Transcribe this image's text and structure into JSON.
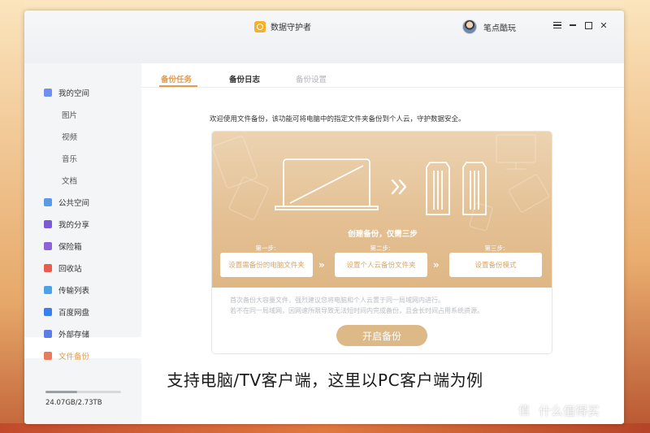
{
  "app": {
    "title": "数据守护者",
    "user_name": "笔点酷玩",
    "colors": {
      "accent": "#e59a4a",
      "hero": "#e3bf92",
      "sidebar_bg": "#f4f5f7"
    }
  },
  "sidebar": {
    "items": [
      {
        "label": "我的空间",
        "icon": "folder-icon",
        "color": "#6d8ff0"
      },
      {
        "label": "图片",
        "sub": true
      },
      {
        "label": "视频",
        "sub": true
      },
      {
        "label": "音乐",
        "sub": true
      },
      {
        "label": "文档",
        "sub": true
      },
      {
        "label": "公共空间",
        "icon": "send-icon",
        "color": "#5a9be8"
      },
      {
        "label": "我的分享",
        "icon": "share-icon",
        "color": "#7c5ad6"
      },
      {
        "label": "保险箱",
        "icon": "safe-icon",
        "color": "#8e63d9"
      },
      {
        "label": "回收站",
        "icon": "trash-icon",
        "color": "#e85d4b"
      },
      {
        "label": "传输列表",
        "icon": "transfer-icon",
        "color": "#4aa3e8"
      },
      {
        "label": "百度网盘",
        "icon": "cloud-icon",
        "color": "#3a7ff0"
      },
      {
        "label": "外部存储",
        "icon": "drive-icon",
        "color": "#5a7ee8"
      },
      {
        "label": "文件备份",
        "icon": "backup-icon",
        "color": "#e97a5c",
        "active": true
      }
    ],
    "storage": {
      "text": "24.07GB/2.73TB",
      "used_fraction": 0.42
    }
  },
  "tabs": [
    {
      "label": "备份任务",
      "state": "active"
    },
    {
      "label": "备份日志",
      "state": "normal"
    },
    {
      "label": "备份设置",
      "state": "disabled"
    }
  ],
  "main": {
    "intro": "欢迎使用文件备份，该功能可将电脑中的指定文件夹备份到个人云，守护数据安全。",
    "hero_title": "创建备份，仅需三步",
    "steps": [
      {
        "label": "第一步:",
        "button": "设置需备份的电脑文件夹"
      },
      {
        "label": "第二步:",
        "button": "设置个人云备份文件夹"
      },
      {
        "label": "第三步:",
        "button": "设置备份模式"
      }
    ],
    "step_arrow": "»",
    "note_line1": "首次备份大容量文件，强烈建议您将电脑和个人云置于同一局域网内进行。",
    "note_line2": "若不在同一局域网，因网速所限导致无法短时间内完成备份，且会长时间占用系统资源。",
    "start_button": "开启备份"
  },
  "caption": "支持电脑/TV客户端，这里以PC客户端为例",
  "watermark": {
    "logo": "值",
    "text": "什么值得买"
  }
}
